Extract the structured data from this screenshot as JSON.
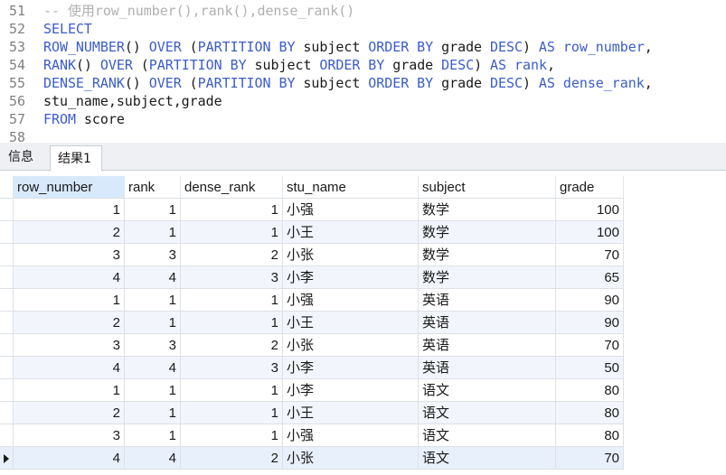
{
  "editor": {
    "lines": [
      {
        "number": "51",
        "segments": [
          {
            "text": "-- 使用row_number(),rank(),dense_rank()",
            "kind": "comment"
          }
        ]
      },
      {
        "number": "52",
        "segments": [
          {
            "text": "SELECT",
            "kind": "keyword"
          }
        ]
      },
      {
        "number": "53",
        "segments": [
          {
            "text": "ROW_NUMBER",
            "kind": "keyword"
          },
          {
            "text": "() ",
            "kind": "plain"
          },
          {
            "text": "OVER",
            "kind": "keyword"
          },
          {
            "text": " (",
            "kind": "plain"
          },
          {
            "text": "PARTITION BY",
            "kind": "keyword"
          },
          {
            "text": " subject ",
            "kind": "plain"
          },
          {
            "text": "ORDER BY",
            "kind": "keyword"
          },
          {
            "text": " grade ",
            "kind": "plain"
          },
          {
            "text": "DESC",
            "kind": "keyword"
          },
          {
            "text": ") ",
            "kind": "plain"
          },
          {
            "text": "AS",
            "kind": "keyword"
          },
          {
            "text": " ",
            "kind": "plain"
          },
          {
            "text": "row_number",
            "kind": "keyword"
          },
          {
            "text": ",",
            "kind": "plain"
          }
        ]
      },
      {
        "number": "54",
        "segments": [
          {
            "text": "RANK",
            "kind": "keyword"
          },
          {
            "text": "() ",
            "kind": "plain"
          },
          {
            "text": "OVER",
            "kind": "keyword"
          },
          {
            "text": " (",
            "kind": "plain"
          },
          {
            "text": "PARTITION BY",
            "kind": "keyword"
          },
          {
            "text": " subject ",
            "kind": "plain"
          },
          {
            "text": "ORDER BY",
            "kind": "keyword"
          },
          {
            "text": " grade ",
            "kind": "plain"
          },
          {
            "text": "DESC",
            "kind": "keyword"
          },
          {
            "text": ") ",
            "kind": "plain"
          },
          {
            "text": "AS",
            "kind": "keyword"
          },
          {
            "text": " ",
            "kind": "plain"
          },
          {
            "text": "rank",
            "kind": "keyword"
          },
          {
            "text": ",",
            "kind": "plain"
          }
        ]
      },
      {
        "number": "55",
        "segments": [
          {
            "text": "DENSE_RANK",
            "kind": "keyword"
          },
          {
            "text": "() ",
            "kind": "plain"
          },
          {
            "text": "OVER",
            "kind": "keyword"
          },
          {
            "text": " (",
            "kind": "plain"
          },
          {
            "text": "PARTITION BY",
            "kind": "keyword"
          },
          {
            "text": " subject ",
            "kind": "plain"
          },
          {
            "text": "ORDER BY",
            "kind": "keyword"
          },
          {
            "text": " grade ",
            "kind": "plain"
          },
          {
            "text": "DESC",
            "kind": "keyword"
          },
          {
            "text": ") ",
            "kind": "plain"
          },
          {
            "text": "AS",
            "kind": "keyword"
          },
          {
            "text": " ",
            "kind": "plain"
          },
          {
            "text": "dense_rank",
            "kind": "keyword"
          },
          {
            "text": ",",
            "kind": "plain"
          }
        ]
      },
      {
        "number": "56",
        "segments": [
          {
            "text": "stu_name,subject,grade",
            "kind": "plain"
          }
        ]
      },
      {
        "number": "57",
        "segments": [
          {
            "text": "FROM",
            "kind": "keyword"
          },
          {
            "text": " score",
            "kind": "plain"
          }
        ]
      },
      {
        "number": "58",
        "segments": []
      }
    ]
  },
  "tabs": {
    "info_label": "信息",
    "result_label": "结果1"
  },
  "grid": {
    "columns": [
      "row_number",
      "rank",
      "dense_rank",
      "stu_name",
      "subject",
      "grade"
    ],
    "rows": [
      [
        "1",
        "1",
        "1",
        "小强",
        "数学",
        "100"
      ],
      [
        "2",
        "1",
        "1",
        "小王",
        "数学",
        "100"
      ],
      [
        "3",
        "3",
        "2",
        "小张",
        "数学",
        "70"
      ],
      [
        "4",
        "4",
        "3",
        "小李",
        "数学",
        "65"
      ],
      [
        "1",
        "1",
        "1",
        "小强",
        "英语",
        "90"
      ],
      [
        "2",
        "1",
        "1",
        "小王",
        "英语",
        "90"
      ],
      [
        "3",
        "3",
        "2",
        "小张",
        "英语",
        "70"
      ],
      [
        "4",
        "4",
        "3",
        "小李",
        "英语",
        "50"
      ],
      [
        "1",
        "1",
        "1",
        "小李",
        "语文",
        "80"
      ],
      [
        "2",
        "1",
        "1",
        "小王",
        "语文",
        "80"
      ],
      [
        "3",
        "1",
        "1",
        "小强",
        "语文",
        "80"
      ],
      [
        "4",
        "4",
        "2",
        "小张",
        "语文",
        "70"
      ]
    ],
    "active_header_index": 0,
    "selected_row_index": 11,
    "alt_row_indices": [
      1,
      3,
      5,
      7,
      9
    ]
  },
  "colors": {
    "keyword": "#3b5ccc",
    "comment": "#b0b0b0",
    "header_active": "#d7e9fb"
  }
}
